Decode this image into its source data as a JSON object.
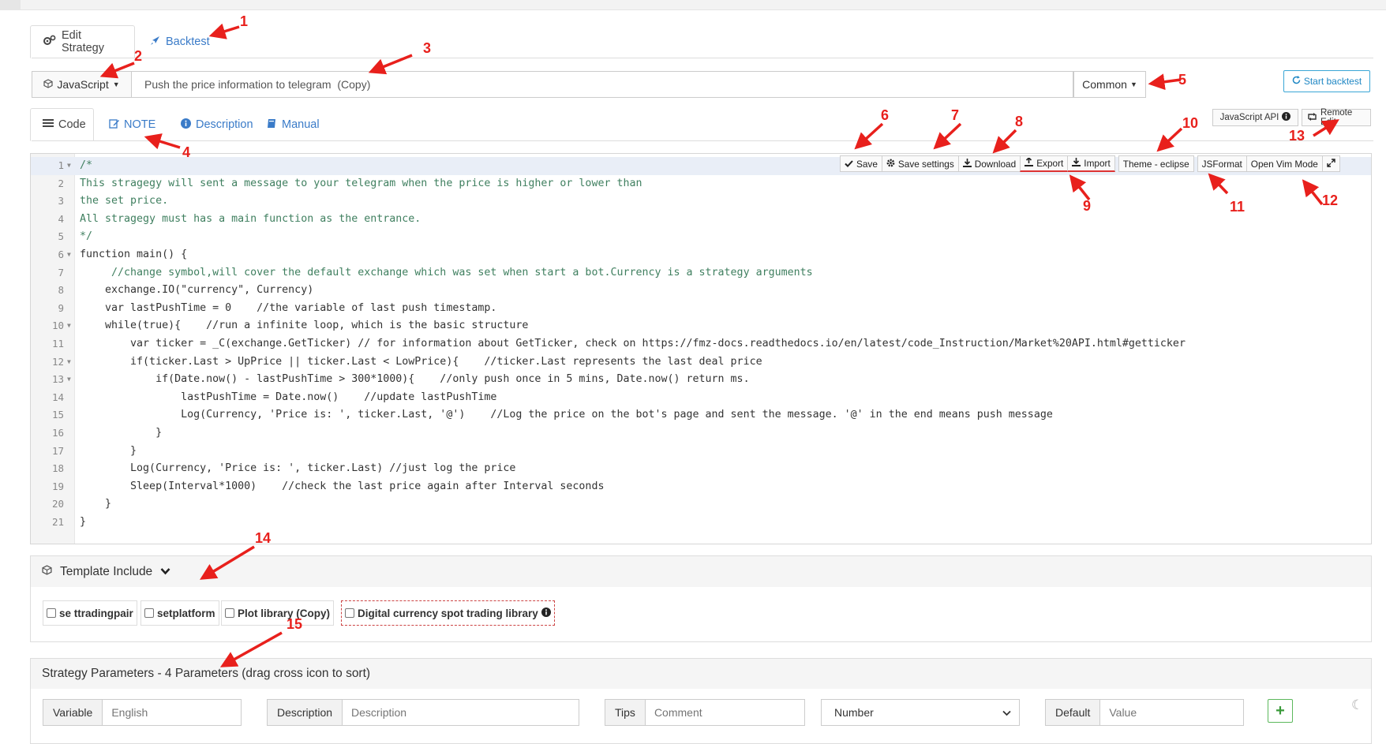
{
  "strategy_tabs": [
    {
      "label": "Edit Strategy",
      "icon": "cogs-icon",
      "active": true
    },
    {
      "label": "Backtest",
      "icon": "rocket-icon",
      "active": false
    }
  ],
  "language": {
    "label": "JavaScript",
    "icon": "cube-icon"
  },
  "strategy_name": {
    "value": "Push the price information to telegram  (Copy)"
  },
  "category": {
    "label": "Common"
  },
  "start_backtest": {
    "label": "Start backtest",
    "icon": "refresh-icon"
  },
  "code_tabs": [
    {
      "label": "Code",
      "icon": "list-icon",
      "active": true
    },
    {
      "label": "NOTE",
      "icon": "edit-icon",
      "active": false
    },
    {
      "label": "Description",
      "icon": "info-icon",
      "active": false
    },
    {
      "label": "Manual",
      "icon": "book-icon",
      "active": false
    }
  ],
  "api_button": {
    "label": "JavaScript API",
    "icon": "info-circle-icon"
  },
  "remote_edit": {
    "label": "Remote Edit",
    "icon": "retweet-icon"
  },
  "editor_toolbar": {
    "save": "Save",
    "save_settings": "Save settings",
    "download": "Download",
    "export": "Export",
    "import": "Import",
    "theme": "Theme - eclipse",
    "jsformat": "JSFormat",
    "vim": "Open Vim Mode"
  },
  "code_lines": [
    {
      "n": "1",
      "text": "/*",
      "fold": true,
      "comment": true
    },
    {
      "n": "2",
      "text": "This stragegy will sent a message to your telegram when the price is higher or lower than",
      "fold": false,
      "comment": true
    },
    {
      "n": "3",
      "text": "the set price.",
      "fold": false,
      "comment": true
    },
    {
      "n": "4",
      "text": "All stragegy must has a main function as the entrance.",
      "fold": false,
      "comment": true
    },
    {
      "n": "5",
      "text": "*/",
      "fold": false,
      "comment": true
    },
    {
      "n": "6",
      "text": "function main() {",
      "fold": true,
      "comment": false
    },
    {
      "n": "7",
      "text": "     //change symbol,will cover the default exchange which was set when start a bot.Currency is a strategy arguments",
      "fold": false,
      "comment": true
    },
    {
      "n": "8",
      "text": "    exchange.IO(\"currency\", Currency)",
      "fold": false,
      "comment": false
    },
    {
      "n": "9",
      "text": "    var lastPushTime = 0    //the variable of last push timestamp.",
      "fold": false,
      "comment": false
    },
    {
      "n": "10",
      "text": "    while(true){    //run a infinite loop, which is the basic structure",
      "fold": true,
      "comment": false
    },
    {
      "n": "11",
      "text": "        var ticker = _C(exchange.GetTicker) // for information about GetTicker, check on https://fmz-docs.readthedocs.io/en/latest/code_Instruction/Market%20API.html#getticker",
      "fold": false,
      "comment": false
    },
    {
      "n": "12",
      "text": "        if(ticker.Last > UpPrice || ticker.Last < LowPrice){    //ticker.Last represents the last deal price",
      "fold": true,
      "comment": false
    },
    {
      "n": "13",
      "text": "            if(Date.now() - lastPushTime > 300*1000){    //only push once in 5 mins, Date.now() return ms.",
      "fold": true,
      "comment": false
    },
    {
      "n": "14",
      "text": "                lastPushTime = Date.now()    //update lastPushTime",
      "fold": false,
      "comment": false
    },
    {
      "n": "15",
      "text": "                Log(Currency, 'Price is: ', ticker.Last, '@')    //Log the price on the bot's page and sent the message. '@' in the end means push message",
      "fold": false,
      "comment": false
    },
    {
      "n": "16",
      "text": "            }",
      "fold": false,
      "comment": false
    },
    {
      "n": "17",
      "text": "        }",
      "fold": false,
      "comment": false
    },
    {
      "n": "18",
      "text": "        Log(Currency, 'Price is: ', ticker.Last) //just log the price",
      "fold": false,
      "comment": false
    },
    {
      "n": "19",
      "text": "        Sleep(Interval*1000)    //check the last price again after Interval seconds",
      "fold": false,
      "comment": false
    },
    {
      "n": "20",
      "text": "    }",
      "fold": false,
      "comment": false
    },
    {
      "n": "21",
      "text": "}",
      "fold": false,
      "comment": false
    }
  ],
  "template_include": {
    "title": "Template Include",
    "items": [
      {
        "label": "se ttradingpair"
      },
      {
        "label": "setplatform"
      },
      {
        "label": "Plot library (Copy)"
      },
      {
        "label": "Digital currency spot trading library"
      }
    ]
  },
  "parameters": {
    "title": "Strategy Parameters - 4 Parameters (drag cross icon to sort)",
    "variable": {
      "addon": "Variable",
      "placeholder": "English"
    },
    "description": {
      "addon": "Description",
      "placeholder": "Description"
    },
    "tips": {
      "addon": "Tips",
      "placeholder": "Comment"
    },
    "type": {
      "selected": "Number"
    },
    "default": {
      "addon": "Default",
      "placeholder": "Value"
    }
  },
  "annotations": [
    "1",
    "2",
    "3",
    "4",
    "5",
    "6",
    "7",
    "8",
    "9",
    "10",
    "11",
    "12",
    "13",
    "14",
    "15"
  ],
  "colors": {
    "annotation": "#e8201c",
    "link": "#3a7bc8",
    "comment": "#3f7f5f",
    "active_line": "#e9eef7"
  }
}
